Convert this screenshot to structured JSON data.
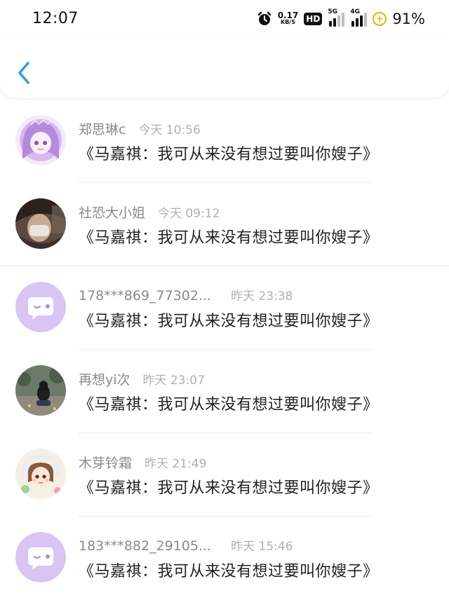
{
  "status_bar": {
    "time": "12:07",
    "net_speed_value": "0.17",
    "net_speed_unit": "KB/S",
    "hd_label": "HD",
    "sim1_tag": "5G",
    "sim2_tag": "4G",
    "battery_percent": "91%",
    "icons": [
      "alarm-icon",
      "hd-icon",
      "signal-5g-icon",
      "signal-4g-icon",
      "battery-saver-icon"
    ]
  },
  "header": {
    "back_icon": "chevron-left-icon",
    "accent_color": "#2f9fe6"
  },
  "comments": [
    {
      "username": "郑思琳c",
      "timestamp": "今天 10:56",
      "text": "《马嘉祺：我可从来没有想过要叫你嫂子》",
      "avatar": "anime-girl-avatar"
    },
    {
      "username": "社恐大小姐",
      "timestamp": "今天 09:12",
      "text": "《马嘉祺：我可从来没有想过要叫你嫂子》",
      "avatar": "photo-avatar"
    },
    {
      "username": "178***869_77302...",
      "timestamp": "昨天 23:38",
      "text": "《马嘉祺：我可从来没有想过要叫你嫂子》",
      "avatar": "default-chat-avatar"
    },
    {
      "username": "再想yi次",
      "timestamp": "昨天 23:07",
      "text": "《马嘉祺：我可从来没有想过要叫你嫂子》",
      "avatar": "photo-avatar"
    },
    {
      "username": "木芽铃霜",
      "timestamp": "昨天 21:49",
      "text": "《马嘉祺：我可从来没有想过要叫你嫂子》",
      "avatar": "cartoon-girl-avatar"
    },
    {
      "username": "183***882_29105...",
      "timestamp": "昨天 15:46",
      "text": "《马嘉祺：我可从来没有想过要叫你嫂子》",
      "avatar": "default-chat-avatar"
    }
  ]
}
